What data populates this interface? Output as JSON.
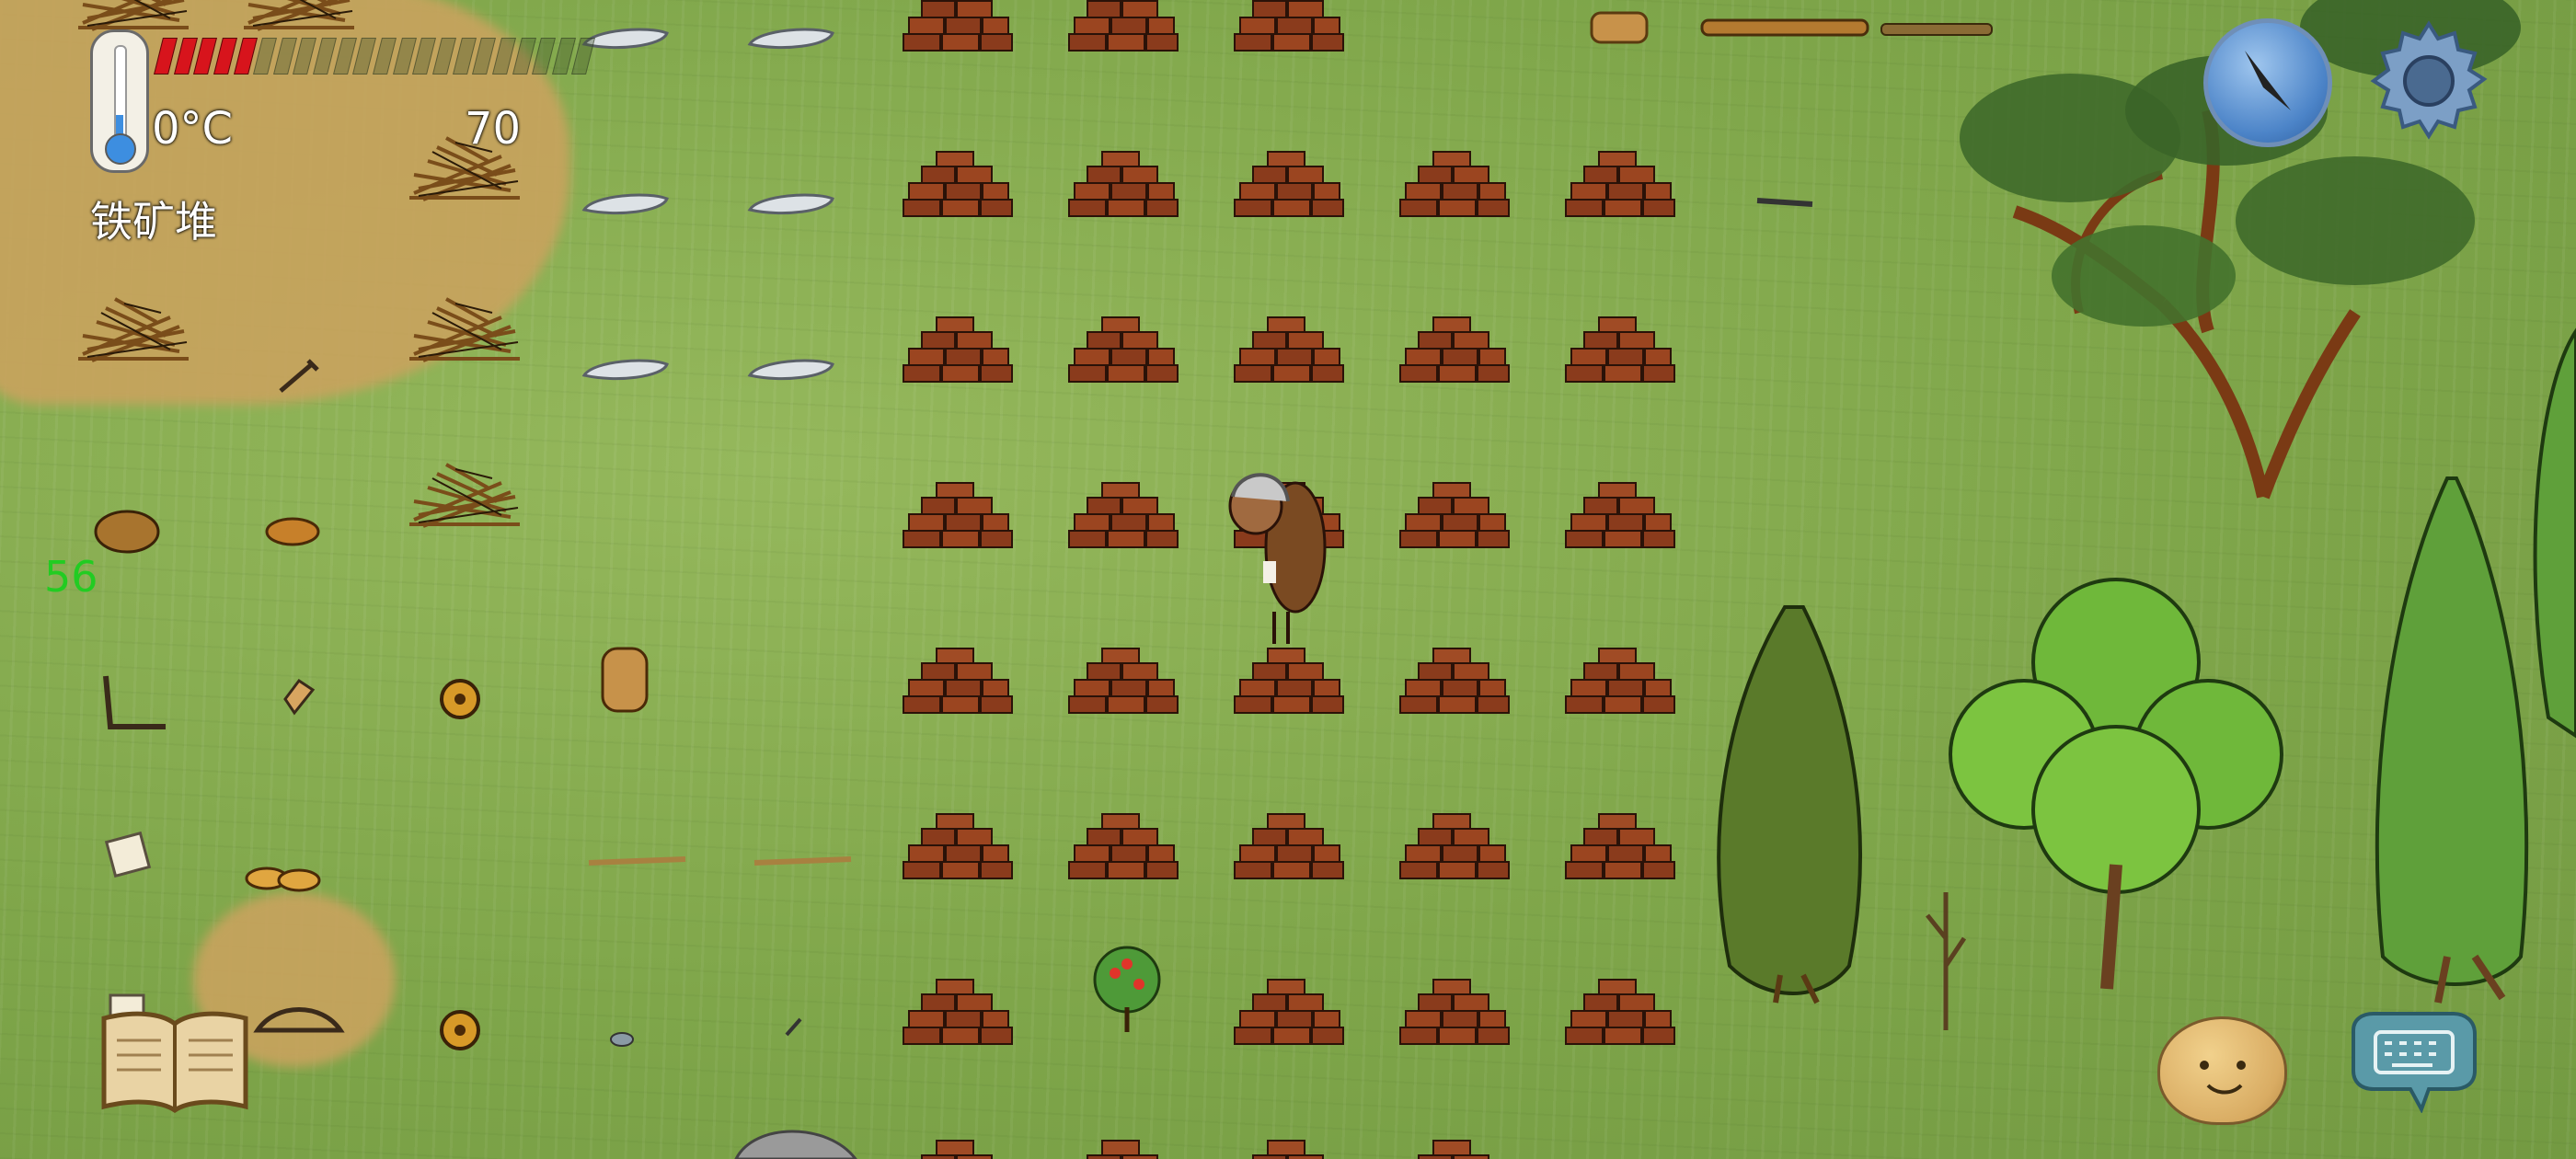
{
  "hud": {
    "temperature": "0°C",
    "counter": "70",
    "hover_label": "铁矿堆",
    "side_number": "56",
    "food_pips_filled": 5,
    "food_pips_total": 22
  },
  "colors": {
    "grass": "#86ad4e",
    "dirt": "#c9a35e",
    "brick": "#8a3b1c",
    "food_red": "#d7141c",
    "side_number_green": "#22cc22"
  },
  "icons": {
    "thermometer": "thermometer-icon",
    "compass": "compass-icon",
    "settings": "gear-icon",
    "recipe_book": "book-icon",
    "emote": "emote-face-icon",
    "chat": "keyboard-chat-icon"
  }
}
